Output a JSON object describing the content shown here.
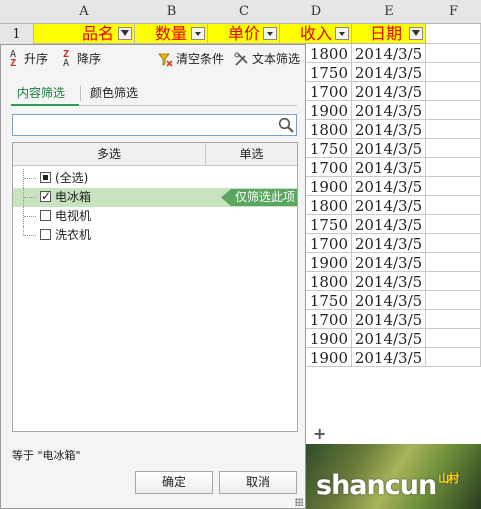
{
  "columns": [
    "A",
    "B",
    "C",
    "D",
    "E",
    "F"
  ],
  "row_header": "1",
  "headers": [
    "品名",
    "数量",
    "单价",
    "收入",
    "日期"
  ],
  "rows": [
    {
      "income": "1800",
      "date": "2014/3/5"
    },
    {
      "income": "1750",
      "date": "2014/3/5"
    },
    {
      "income": "1700",
      "date": "2014/3/5"
    },
    {
      "income": "1900",
      "date": "2014/3/5"
    },
    {
      "income": "1800",
      "date": "2014/3/5"
    },
    {
      "income": "1750",
      "date": "2014/3/5"
    },
    {
      "income": "1700",
      "date": "2014/3/5"
    },
    {
      "income": "1900",
      "date": "2014/3/5"
    },
    {
      "income": "1800",
      "date": "2014/3/5"
    },
    {
      "income": "1750",
      "date": "2014/3/5"
    },
    {
      "income": "1700",
      "date": "2014/3/5"
    },
    {
      "income": "1900",
      "date": "2014/3/5"
    },
    {
      "income": "1800",
      "date": "2014/3/5"
    },
    {
      "income": "1750",
      "date": "2014/3/5"
    },
    {
      "income": "1700",
      "date": "2014/3/5"
    },
    {
      "income": "1900",
      "date": "2014/3/5"
    },
    {
      "income": "1900",
      "date": "2014/3/5"
    }
  ],
  "add_sheet_label": "+",
  "watermark": {
    "main": "shancun",
    "sub": "山村"
  },
  "filter": {
    "sort_asc": "升序",
    "sort_desc": "降序",
    "clear": "清空条件",
    "text_filter": "文本筛选",
    "tabs": [
      "内容筛选",
      "颜色筛选"
    ],
    "search_placeholder": "",
    "col_multi": "多选",
    "col_single": "单选",
    "items": [
      {
        "label": "(全选)",
        "state": "partial"
      },
      {
        "label": "电冰箱",
        "state": "checked",
        "selected": true
      },
      {
        "label": "电视机",
        "state": "unchecked"
      },
      {
        "label": "洗衣机",
        "state": "unchecked"
      }
    ],
    "only_this": "仅筛选此项",
    "status": "等于 \"电冰箱\"",
    "ok": "确定",
    "cancel": "取消"
  }
}
